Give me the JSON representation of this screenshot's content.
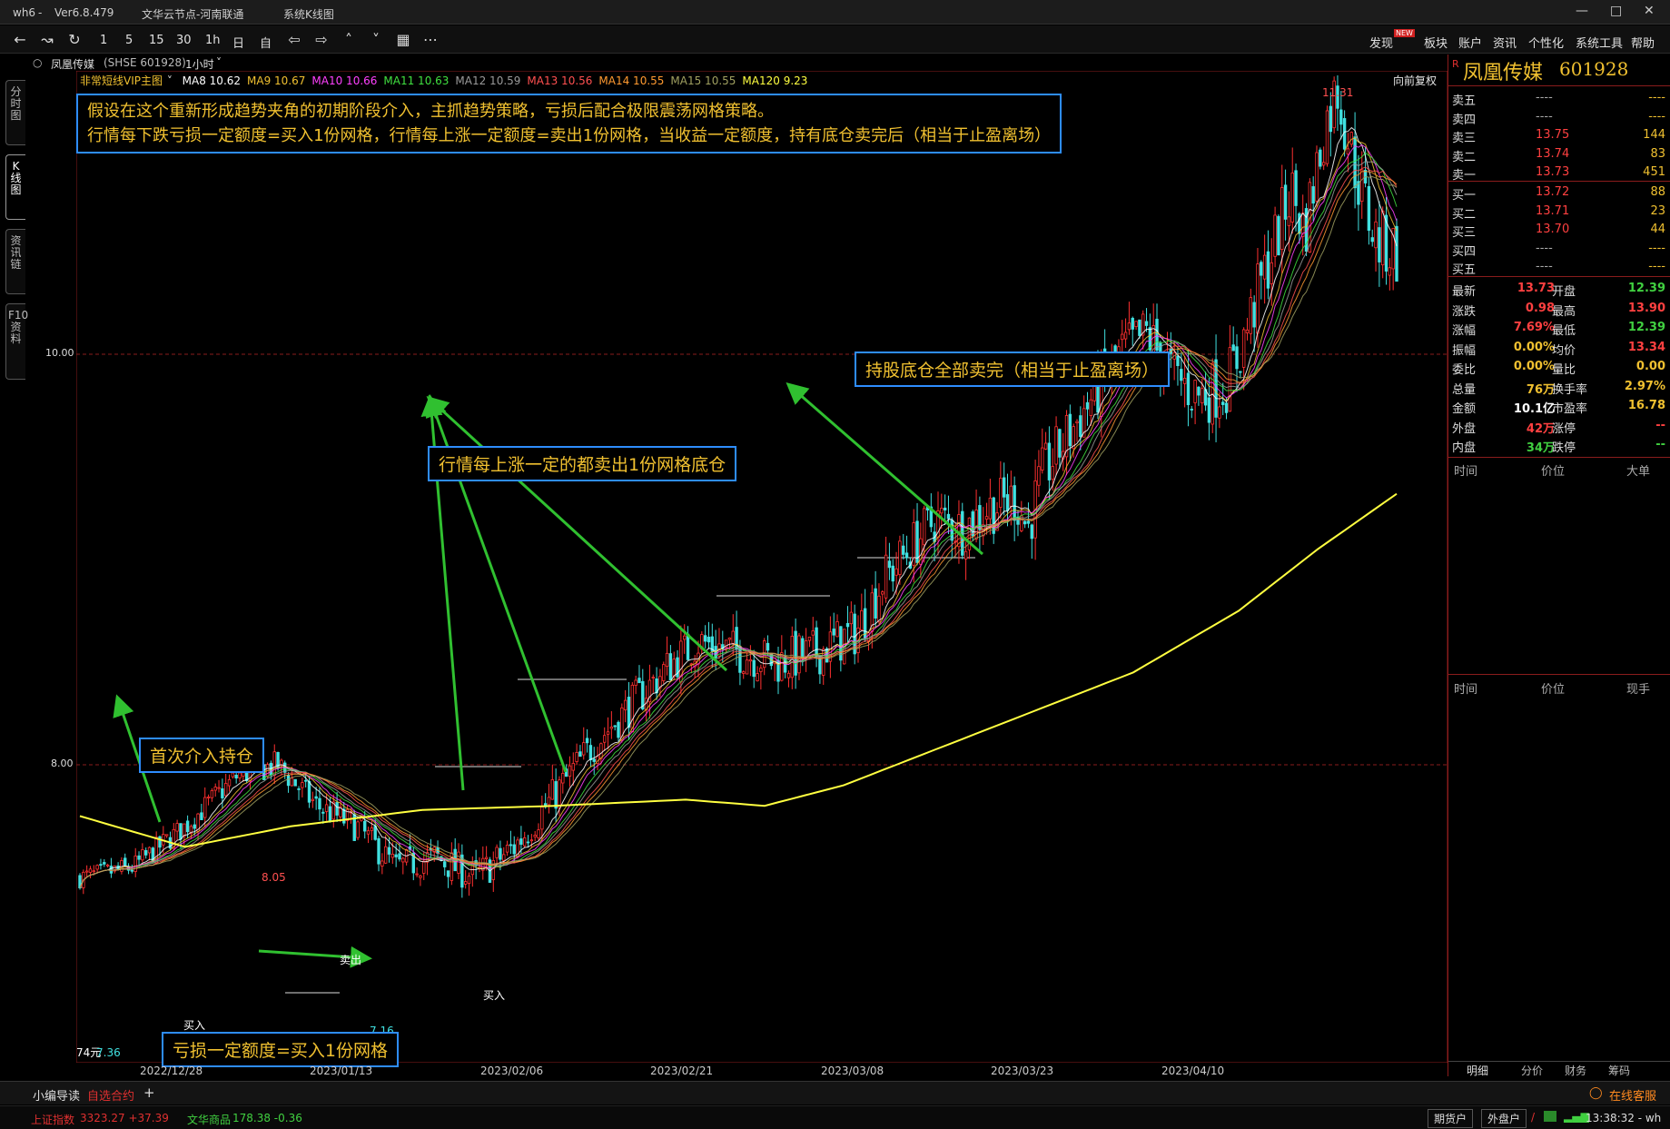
{
  "window": {
    "app": "wh6",
    "version": "Ver6.8.479",
    "server": "文华云节点-河南联通",
    "system": "系统K线图"
  },
  "toolbar": {
    "periods": [
      "1",
      "5",
      "15",
      "30",
      "1h",
      "日",
      "自"
    ],
    "menus": [
      "发现",
      "板块",
      "账户",
      "资讯",
      "个性化",
      "系统工具",
      "帮助"
    ],
    "badge": "NEW"
  },
  "side_tabs": [
    "分时图",
    "K线图",
    "资讯链",
    "F10资料"
  ],
  "stock": {
    "name": "凤凰传媒",
    "code_label": "(SHSE 601928)",
    "period": "1小时",
    "indicator": "非常短线VIP主图",
    "restore": "向前复权",
    "code": "601928"
  },
  "ma": [
    {
      "label": "MA8 10.62",
      "color": "#ffffff"
    },
    {
      "label": "MA9 10.67",
      "color": "#f0c030"
    },
    {
      "label": "MA10 10.66",
      "color": "#ff40ff"
    },
    {
      "label": "MA11 10.63",
      "color": "#40e040"
    },
    {
      "label": "MA12 10.59",
      "color": "#9a9a9a"
    },
    {
      "label": "MA13 10.56",
      "color": "#ff5050"
    },
    {
      "label": "MA14 10.55",
      "color": "#ff9a30"
    },
    {
      "label": "MA15 10.55",
      "color": "#a0a060"
    },
    {
      "label": "MA120 9.23",
      "color": "#ffff40"
    }
  ],
  "notes": {
    "main1": "假设在这个重新形成趋势夹角的初期阶段介入，主抓趋势策略，亏损后配合极限震荡网格策略。",
    "main2": "行情每下跌亏损一定额度=买入1份网格，行情每上涨一定额度=卖出1份网格，当收益一定额度，持有底仓卖完后（相当于止盈离场）",
    "first": "首次介入持仓",
    "loss": "亏损一定额度=买入1份网格",
    "rise": "行情每上涨一定的都卖出1份网格底仓",
    "exit": "持股底仓全部卖完（相当于止盈离场）"
  },
  "marks": {
    "buy1": "买入",
    "sell": "卖出",
    "buy2": "买入",
    "high": "11.31",
    "p805": "8.05",
    "p716": "7.16",
    "low": "7.36",
    "low_prefix": "74元"
  },
  "price_ticks": [
    "10.00",
    "8.00"
  ],
  "dates": [
    "2022/12/28",
    "2023/01/13",
    "2023/02/06",
    "2023/02/21",
    "2023/03/08",
    "2023/03/23",
    "2023/04/10"
  ],
  "chart_data": {
    "type": "candlestick",
    "title": "凤凰传媒 (SHSE 601928) 1小时",
    "ylim": [
      6.9,
      11.5
    ],
    "x": [
      "2022/12/28",
      "2023/01/13",
      "2023/02/06",
      "2023/02/21",
      "2023/03/08",
      "2023/03/23",
      "2023/04/10"
    ],
    "close_path": [
      [
        0,
        7.45
      ],
      [
        0.04,
        7.5
      ],
      [
        0.08,
        7.7
      ],
      [
        0.12,
        7.95
      ],
      [
        0.15,
        8.0
      ],
      [
        0.18,
        7.8
      ],
      [
        0.21,
        7.7
      ],
      [
        0.24,
        7.5
      ],
      [
        0.27,
        7.55
      ],
      [
        0.3,
        7.45
      ],
      [
        0.33,
        7.6
      ],
      [
        0.36,
        7.85
      ],
      [
        0.39,
        8.1
      ],
      [
        0.42,
        8.3
      ],
      [
        0.45,
        8.5
      ],
      [
        0.47,
        8.6
      ],
      [
        0.5,
        8.55
      ],
      [
        0.53,
        8.5
      ],
      [
        0.56,
        8.55
      ],
      [
        0.59,
        8.65
      ],
      [
        0.61,
        8.9
      ],
      [
        0.63,
        9.05
      ],
      [
        0.65,
        9.2
      ],
      [
        0.67,
        9.15
      ],
      [
        0.69,
        9.25
      ],
      [
        0.71,
        9.3
      ],
      [
        0.72,
        9.15
      ],
      [
        0.73,
        9.4
      ],
      [
        0.75,
        9.6
      ],
      [
        0.77,
        9.8
      ],
      [
        0.79,
        10.0
      ],
      [
        0.81,
        10.1
      ],
      [
        0.83,
        9.9
      ],
      [
        0.85,
        9.8
      ],
      [
        0.87,
        9.85
      ],
      [
        0.88,
        10.0
      ],
      [
        0.9,
        10.4
      ],
      [
        0.92,
        10.8
      ],
      [
        0.93,
        10.6
      ],
      [
        0.945,
        11.1
      ],
      [
        0.955,
        11.3
      ],
      [
        0.965,
        11.0
      ],
      [
        0.975,
        10.75
      ],
      [
        0.985,
        10.55
      ],
      [
        1.0,
        10.5
      ]
    ],
    "ma120_path": [
      [
        0,
        7.75
      ],
      [
        0.08,
        7.6
      ],
      [
        0.16,
        7.7
      ],
      [
        0.26,
        7.78
      ],
      [
        0.36,
        7.8
      ],
      [
        0.46,
        7.83
      ],
      [
        0.52,
        7.8
      ],
      [
        0.58,
        7.9
      ],
      [
        0.64,
        8.05
      ],
      [
        0.72,
        8.25
      ],
      [
        0.8,
        8.45
      ],
      [
        0.88,
        8.75
      ],
      [
        0.94,
        9.05
      ],
      [
        1.0,
        9.32
      ]
    ],
    "levels": [
      10.0,
      8.0
    ],
    "quote": {
      "sell": [
        [
          "卖五",
          "----",
          "----"
        ],
        [
          "卖四",
          "----",
          "----"
        ],
        [
          "卖三",
          "13.75",
          "144"
        ],
        [
          "卖二",
          "13.74",
          "83"
        ],
        [
          "卖一",
          "13.73",
          "451"
        ]
      ],
      "buy": [
        [
          "买一",
          "13.72",
          "88"
        ],
        [
          "买二",
          "13.71",
          "23"
        ],
        [
          "买三",
          "13.70",
          "44"
        ],
        [
          "买四",
          "----",
          "----"
        ],
        [
          "买五",
          "----",
          "----"
        ]
      ]
    }
  },
  "stats": [
    [
      "最新",
      "13.73",
      "开盘",
      "12.39"
    ],
    [
      "涨跌",
      "0.98",
      "最高",
      "13.90"
    ],
    [
      "涨幅",
      "7.69%",
      "最低",
      "12.39"
    ],
    [
      "振幅",
      "0.00%",
      "均价",
      "13.34"
    ],
    [
      "委比",
      "0.00%",
      "量比",
      "0.00"
    ],
    [
      "总量",
      "76万",
      "换手率",
      "2.97%"
    ],
    [
      "金额",
      "10.1亿",
      "市盈率",
      "16.78"
    ],
    [
      "外盘",
      "42万",
      "涨停",
      "--"
    ],
    [
      "内盘",
      "34万",
      "跌停",
      "--"
    ]
  ],
  "tick_headers1": [
    "时间",
    "价位",
    "大单"
  ],
  "tick_headers2": [
    "时间",
    "价位",
    "现手"
  ],
  "bottom_tabs": [
    "明细",
    "分价",
    "财务",
    "筹码"
  ],
  "bottombar": {
    "guide": "小编导读",
    "watch": "自选合约",
    "add": "+",
    "service": "在线客服"
  },
  "status": {
    "idx1": "上证指数",
    "idx1_val": "3323.27 +37.39",
    "idx2": "文华商品",
    "idx2_val": "178.38 -0.36",
    "btn1": "期货户",
    "btn2": "外盘户",
    "time": "13:38:32 - wh"
  }
}
